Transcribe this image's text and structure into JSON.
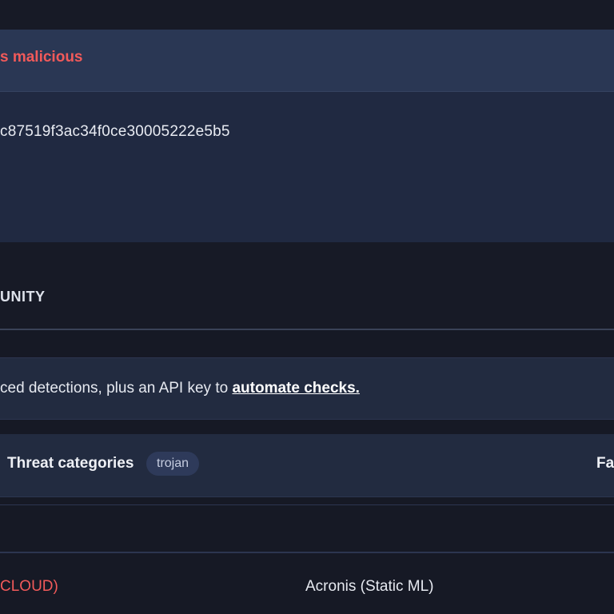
{
  "verdict": {
    "text": "s malicious"
  },
  "file": {
    "hash_fragment": "c87519f3ac34f0ce30005222e5b5"
  },
  "tabs": {
    "community_label": "UNITY"
  },
  "promo": {
    "text": "ced detections, plus an API key to ",
    "link_label": "automate checks."
  },
  "threat": {
    "categories_label": "Threat categories",
    "category_tag": "trojan",
    "family_label": "Fa"
  },
  "engines": {
    "row": {
      "result": "CLOUD)",
      "engine": "Acronis (Static ML)"
    }
  },
  "colors": {
    "malicious": "#f25a5a",
    "banner_bg": "#2a3754",
    "panel_bg": "#202941",
    "page_bg": "#161925"
  }
}
